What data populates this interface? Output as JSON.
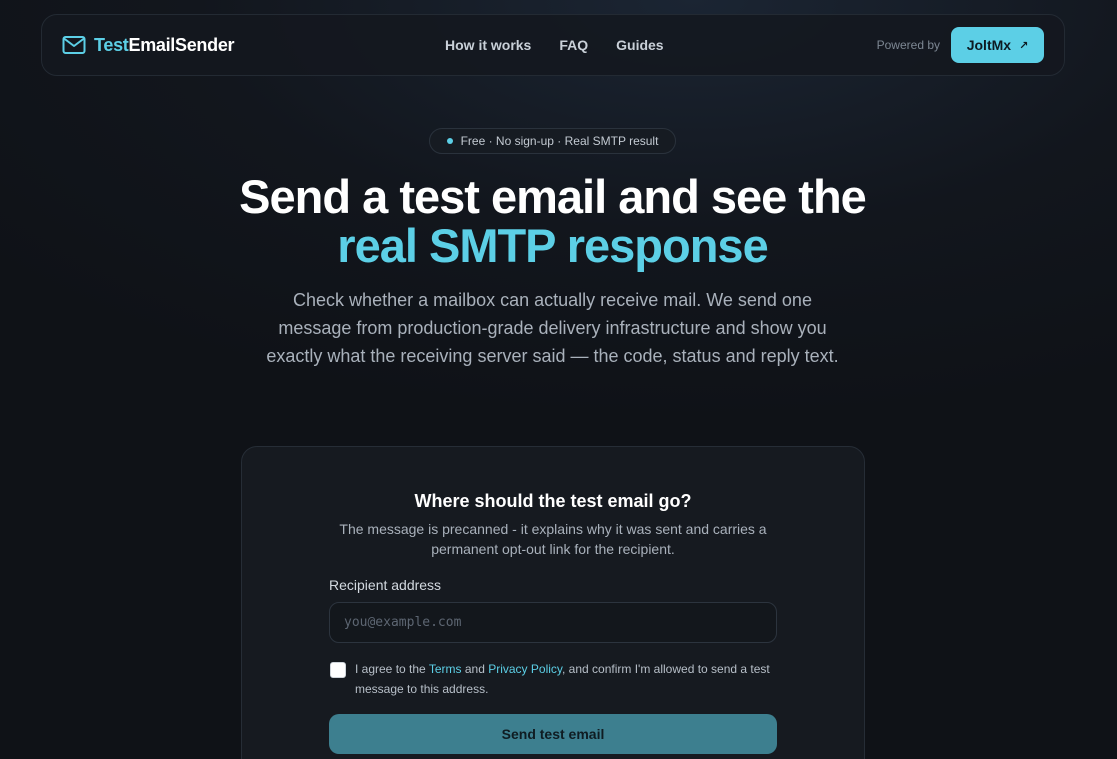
{
  "nav": {
    "brand_part1": "Test",
    "brand_part2": "EmailSender",
    "links": [
      "How it works",
      "FAQ",
      "Guides"
    ],
    "powered_by": "Powered by",
    "partner_button": "JoltMx",
    "partner_arrow": "↗"
  },
  "hero": {
    "badge": "Free · No sign-up · Real SMTP result",
    "headline_plain": "Send a test email and see the ",
    "headline_accent": "real SMTP response",
    "subtitle": "Check whether a mailbox can actually receive mail. We send one message from production-grade delivery infrastructure and show you exactly what the receiving server said — the code, status and reply text."
  },
  "form": {
    "title": "Where should the test email go?",
    "description": "The message is precanned - it explains why it was sent and carries a permanent opt-out link for the recipient.",
    "recipient_label": "Recipient address",
    "recipient_placeholder": "you@example.com",
    "recipient_value": "",
    "agree_prefix": "I agree to the ",
    "terms_link": "Terms",
    "agree_and": " and ",
    "privacy_link": "Privacy Policy",
    "agree_suffix": ", and confirm I'm allowed to send a test message to this address.",
    "agree_checked": false,
    "submit_label": "Send test email"
  },
  "colors": {
    "accent": "#5ccfe6",
    "background": "#101318",
    "card": "#161a20",
    "submit": "#3d7f8f"
  }
}
